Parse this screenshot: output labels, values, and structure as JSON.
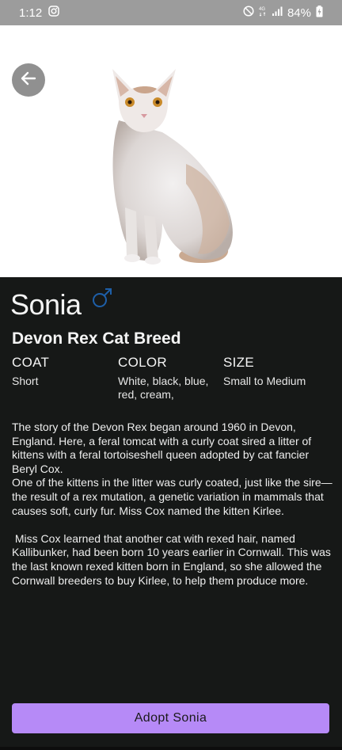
{
  "status_bar": {
    "time": "1:12",
    "battery": "84%",
    "icons": [
      "instagram-icon",
      "do-not-disturb-icon",
      "4g-icon",
      "signal-icon",
      "battery-charging-icon"
    ]
  },
  "header": {
    "back_icon": "arrow-left-icon"
  },
  "pet": {
    "name": "Sonia",
    "gender_icon": "male-symbol-icon",
    "breed": "Devon Rex Cat Breed",
    "attributes": [
      {
        "label": "COAT",
        "value": "Short"
      },
      {
        "label": "COLOR",
        "value": "White, black, blue, red, cream,"
      },
      {
        "label": "SIZE",
        "value": "Small to Medium"
      }
    ],
    "description": [
      "The story of the Devon Rex began around 1960 in Devon, England. Here, a feral tomcat with a curly coat sired a litter of kittens with a feral tortoiseshell queen adopted by cat fancier Beryl Cox.",
      "One of the kittens in the litter was curly coated, just like the sire—the result of a rex mutation, a genetic variation in mammals that causes soft, curly fur. Miss Cox named the kitten Kirlee.",
      "",
      " Miss Cox learned that another cat with rexed hair, named Kallibunker, had been born 10 years earlier in Cornwall. This was the last known rexed kitten born in England, so she allowed the Cornwall breeders to buy Kirlee, to help them produce more."
    ]
  },
  "actions": {
    "adopt_label": "Adopt Sonia"
  },
  "colors": {
    "accent": "#b68af7",
    "background": "#161817",
    "status_bar": "#9c9c9c",
    "gender_icon": "#1e5fa8"
  }
}
